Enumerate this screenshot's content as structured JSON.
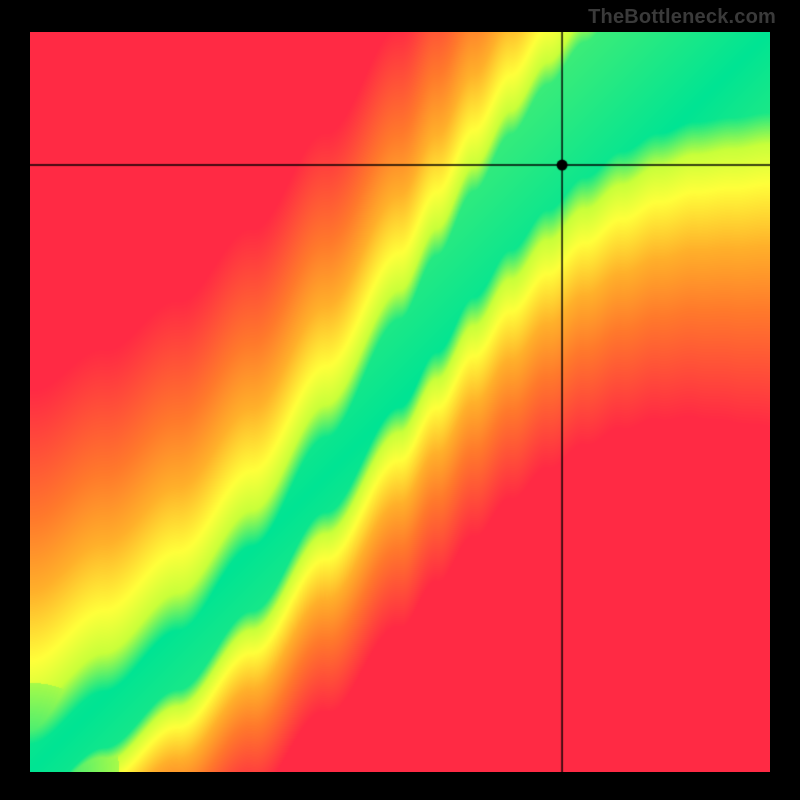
{
  "watermark": "TheBottleneck.com",
  "colors": {
    "background": "#000000",
    "watermark_text": "#3a3a3a",
    "marker": "#000000",
    "crosshair": "#000000",
    "heatmap_stops": {
      "red": "#ff2a44",
      "orange": "#ff7a2b",
      "amber": "#ffb02a",
      "yellow": "#ffff3a",
      "yellowgreen": "#c8ff3a",
      "green": "#00e493"
    }
  },
  "chart_data": {
    "type": "heatmap",
    "title": "",
    "xlabel": "",
    "ylabel": "",
    "xlim": [
      0,
      100
    ],
    "ylim": [
      0,
      100
    ],
    "ridge": {
      "description": "Approximate green/optimal ridge centerline as (x, y) pairs on the 0–100 grid, running from bottom-left to top-right. The ridge is the region of best match; color falls off toward red away from it on either side.",
      "points": [
        [
          0,
          0
        ],
        [
          10,
          7
        ],
        [
          20,
          15
        ],
        [
          30,
          26
        ],
        [
          40,
          40
        ],
        [
          50,
          55
        ],
        [
          55,
          63
        ],
        [
          60,
          71
        ],
        [
          65,
          78
        ],
        [
          70,
          84
        ],
        [
          75,
          89
        ],
        [
          80,
          93
        ],
        [
          85,
          96
        ],
        [
          90,
          98
        ],
        [
          95,
          99
        ],
        [
          100,
          100
        ]
      ],
      "half_width_percent": 5
    },
    "marker": {
      "x": 72,
      "y": 82,
      "note": "Black dot with full-width/full-height crosshair lines through it."
    },
    "legend": []
  }
}
